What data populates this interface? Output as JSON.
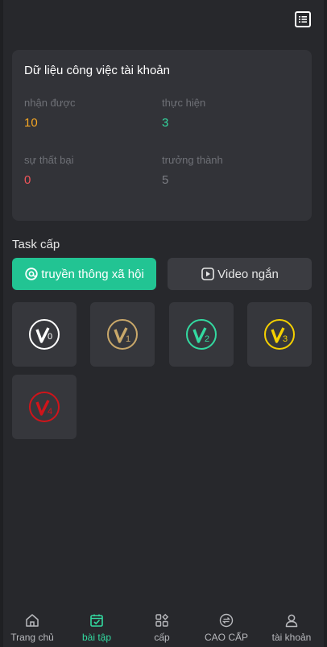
{
  "header": {
    "menu_icon": "list-icon"
  },
  "stats": {
    "title": "Dữ liệu công việc tài khoản",
    "items": [
      {
        "label": "nhận được",
        "value": "10",
        "color": "#f5a623"
      },
      {
        "label": "thực hiện",
        "value": "3",
        "color": "#33d9a0"
      },
      {
        "label": "sự thất bại",
        "value": "0",
        "color": "#f2555a"
      },
      {
        "label": "trưởng thành",
        "value": "5",
        "color": "#7b7d83"
      }
    ]
  },
  "task_level": {
    "title": "Task cấp",
    "tabs": [
      {
        "label": "truyền thông xã hội",
        "icon": "social-icon",
        "active": true
      },
      {
        "label": "Video ngắn",
        "icon": "play-icon",
        "active": false
      }
    ],
    "levels": [
      {
        "sub": "0",
        "color": "#ffffff"
      },
      {
        "sub": "1",
        "color": "#c9a86a"
      },
      {
        "sub": "2",
        "color": "#33d9a0"
      },
      {
        "sub": "3",
        "color": "#f5d000"
      },
      {
        "sub": "4",
        "color": "#d0141a"
      }
    ]
  },
  "bottom_nav": [
    {
      "label": "Trang chủ",
      "icon": "home-icon",
      "active": false
    },
    {
      "label": "bài tập",
      "icon": "task-icon",
      "active": true
    },
    {
      "label": "cấp",
      "icon": "grid-icon",
      "active": false
    },
    {
      "label": "CAO CẤP",
      "icon": "exchange-icon",
      "active": false
    },
    {
      "label": "tài khoản",
      "icon": "user-icon",
      "active": false
    }
  ],
  "colors": {
    "accent": "#22c493",
    "background": "#27282c",
    "card": "#323338"
  }
}
